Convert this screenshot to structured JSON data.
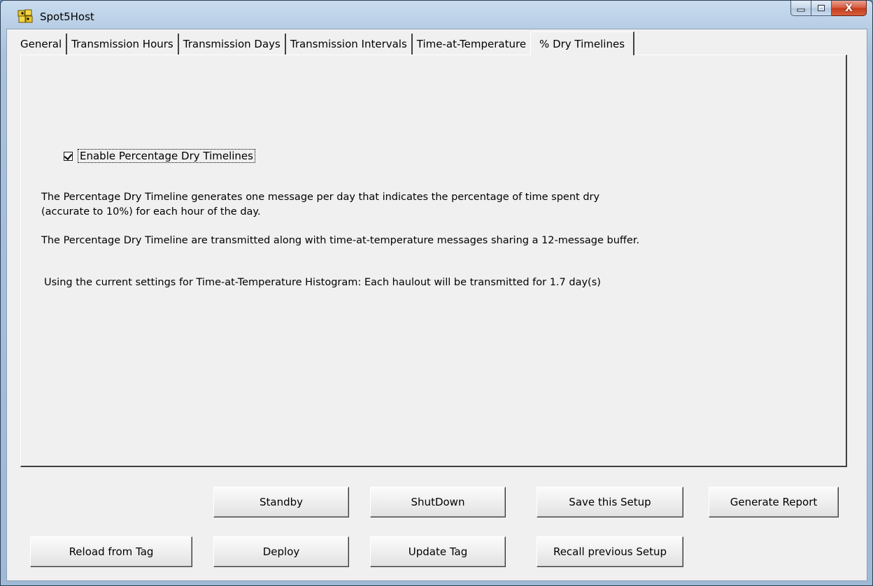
{
  "window": {
    "title": "Spot5Host",
    "minimize_glyph": "–",
    "close_glyph": "X"
  },
  "tabs": [
    {
      "label": "General"
    },
    {
      "label": "Transmission Hours"
    },
    {
      "label": "Transmission Days"
    },
    {
      "label": "Transmission Intervals"
    },
    {
      "label": "Time-at-Temperature"
    },
    {
      "label": "% Dry Timelines",
      "active": true
    }
  ],
  "panel": {
    "enable_checkbox": {
      "label": "Enable Percentage Dry Timelines",
      "checked": true
    },
    "description_line1": "The Percentage Dry Timeline generates one message per day that indicates the percentage of time spent dry",
    "description_line2": "(accurate to 10%) for each hour of the day.",
    "transmit_note": "The Percentage Dry Timeline are transmitted along with time-at-temperature messages sharing a 12-message buffer.",
    "haulout_note": "Using the current settings for Time-at-Temperature Histogram:  Each haulout will be transmitted for 1.7 day(s)"
  },
  "buttons": {
    "standby": "Standby",
    "shutdown": "ShutDown",
    "save_setup": "Save this Setup",
    "generate_report": "Generate Report",
    "reload_from_tag": "Reload from Tag",
    "deploy": "Deploy",
    "update_tag": "Update Tag",
    "recall_setup": "Recall previous Setup"
  },
  "colors": {
    "panel_bg": "#f0f0f0",
    "title_bar": "#c9dcef",
    "close_button": "#c33a1c"
  }
}
